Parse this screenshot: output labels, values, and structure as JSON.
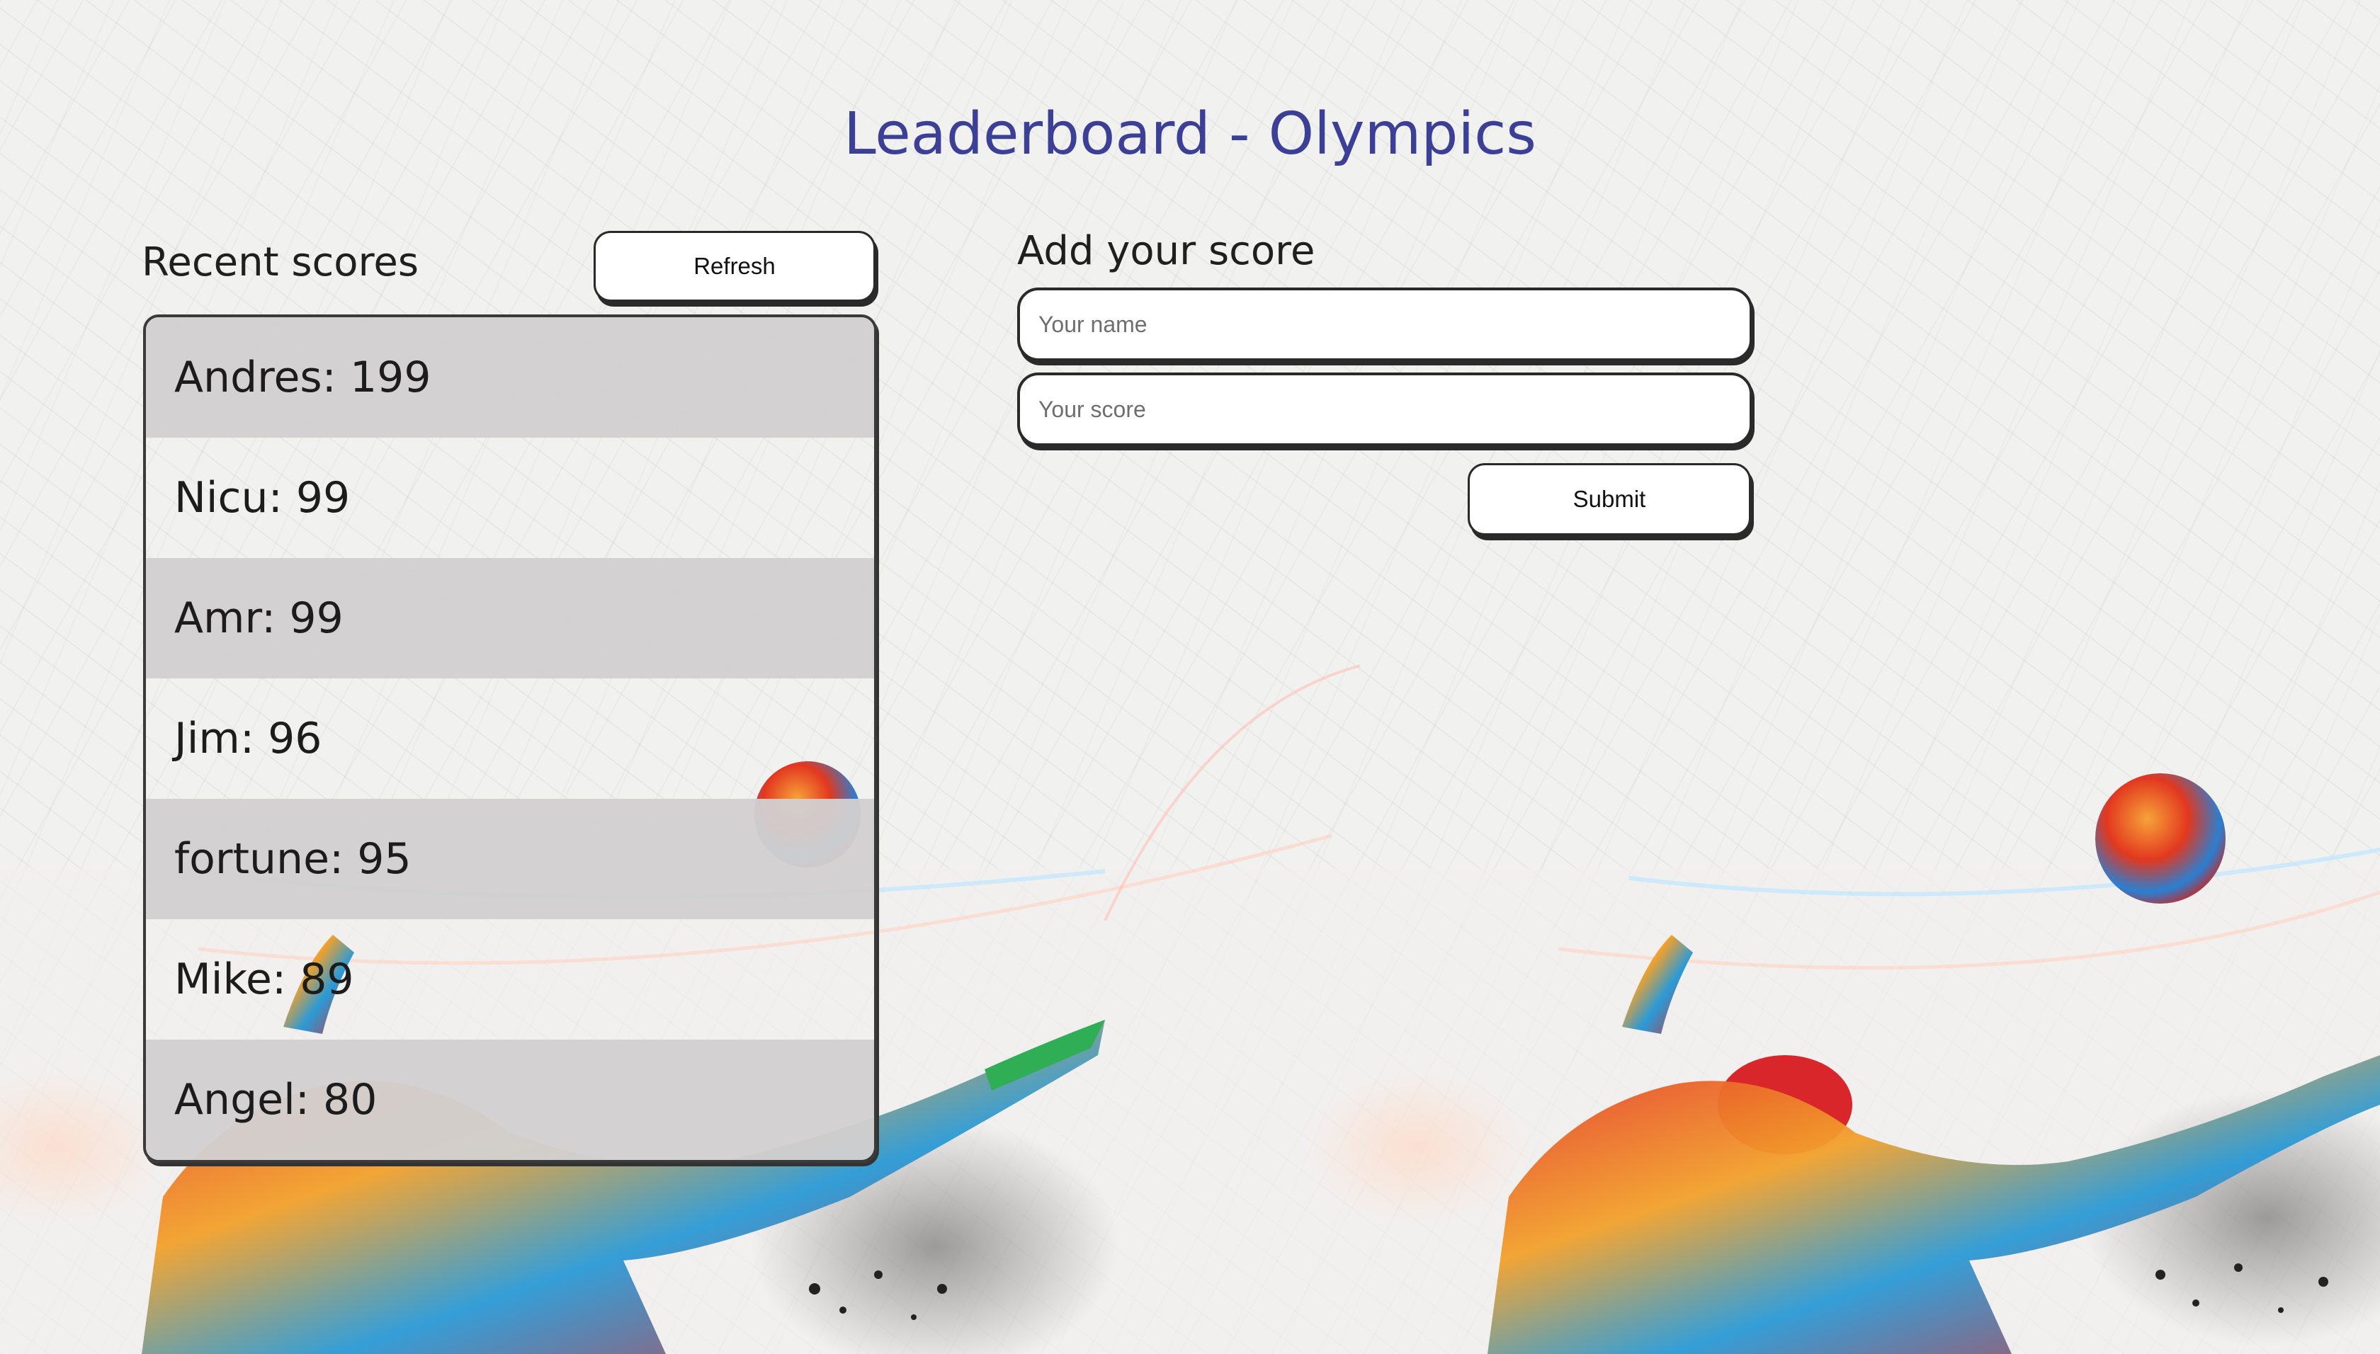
{
  "page": {
    "title": "Leaderboard - Olympics",
    "theme_colors": {
      "title": "#3b3f96",
      "row_shade": "#d1cfcf",
      "border": "#2a2a2a"
    }
  },
  "recent_scores": {
    "heading": "Recent scores",
    "refresh_label": "Refresh",
    "entries": [
      "Andres: 199",
      "Nicu: 99",
      "Amr: 99",
      "Jim: 96",
      "fortune: 95",
      "Mike: 89",
      "Angel: 80"
    ]
  },
  "add_score": {
    "heading": "Add your score",
    "name_placeholder": "Your name",
    "name_value": "",
    "score_placeholder": "Your score",
    "score_value": "",
    "submit_label": "Submit"
  },
  "decoration": {
    "background_image": "athlete-illustration",
    "icons": [
      "ball-icon"
    ]
  }
}
